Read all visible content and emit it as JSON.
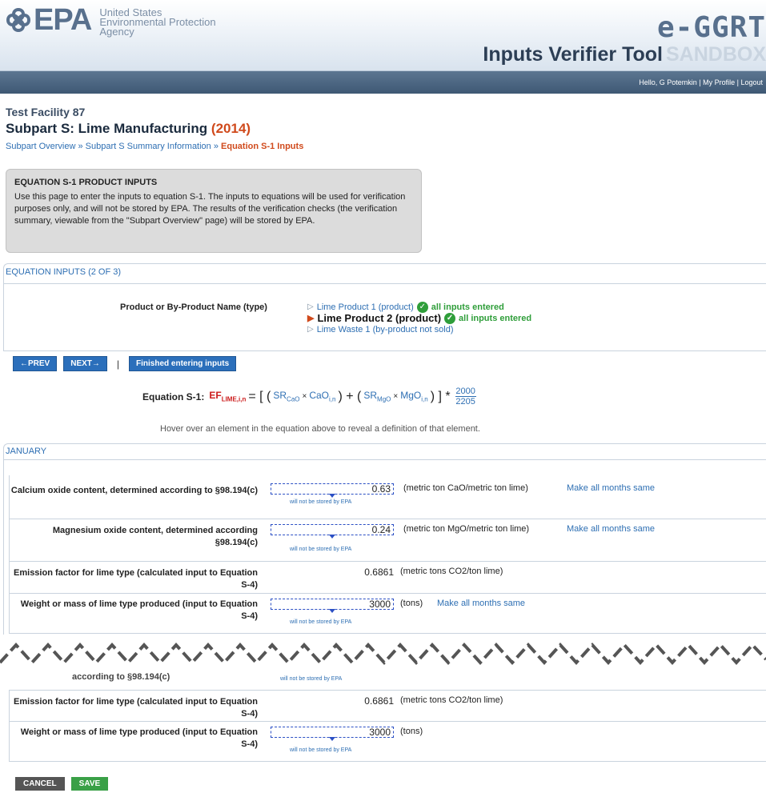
{
  "header": {
    "logo_text": "EPA",
    "agency_line1": "United States",
    "agency_line2": "Environmental Protection",
    "agency_line3": "Agency",
    "product": "e-GGRT",
    "tool": "Inputs Verifier Tool",
    "env": "SANDBOX",
    "user_greeting": "Hello, G Potemkin",
    "my_profile": "My Profile",
    "logout": "Logout"
  },
  "page": {
    "facility": "Test Facility 87",
    "subpart": "Subpart S: Lime Manufacturing",
    "year": "(2014)",
    "breadcrumb": [
      "Subpart Overview",
      "Subpart S Summary Information",
      "Equation S-1 Inputs"
    ]
  },
  "infobox": {
    "heading": "EQUATION S-1 PRODUCT INPUTS",
    "text": "Use this page to enter the inputs to equation S-1. The inputs to equations will be used for verification purposes only, and will not be stored by EPA. The results of the verification checks (the verification summary, viewable from the \"Subpart Overview\" page) will be stored by EPA."
  },
  "equation_inputs": {
    "title": "EQUATION INPUTS (2 OF 3)",
    "product_label": "Product or By-Product Name (type)",
    "products": [
      {
        "name": "Lime Product 1 (product)",
        "status": "all inputs entered"
      },
      {
        "name": "Lime Product 2 (product)",
        "status": "all inputs entered"
      },
      {
        "name": "Lime Waste 1 (by-product not sold)",
        "status": ""
      }
    ]
  },
  "nav": {
    "prev": "←PREV",
    "next": "NEXT→",
    "sep": "|",
    "finished": "Finished entering inputs"
  },
  "equation": {
    "label": "Equation S-1:",
    "ef": "EF",
    "ef_sub": "LIME,i,n",
    "open": "= [ (",
    "sr_cao": "SR",
    "sr_cao_sub": "CaO",
    "times1": "×",
    "cao": "CaO",
    "cao_sub": "i,n",
    "mid": ") + (",
    "sr_mgo": "SR",
    "sr_mgo_sub": "MgO",
    "times2": "×",
    "mgo": "MgO",
    "mgo_sub": "i,n",
    "close": ") ] *",
    "numerator": "2000",
    "denominator": "2205",
    "hover_note": "Hover over an element in the equation above to reveal a definition of that element."
  },
  "january": {
    "title": "JANUARY",
    "rows": [
      {
        "label": "Calcium oxide content, determined according to §98.194(c)",
        "value": "0.63",
        "unit": "(metric ton CaO/metric ton lime)",
        "link": "Make all months same"
      },
      {
        "label": "Magnesium oxide content, determined according §98.194(c)",
        "value": "0.24",
        "unit": "(metric ton MgO/metric ton lime)",
        "link": "Make all months same"
      },
      {
        "label": "Emission factor for lime type (calculated input to Equation S-4)",
        "value": "0.6861",
        "unit": "(metric tons CO2/ton lime)"
      },
      {
        "label": "Weight or mass of lime type produced (input to Equation S-4)",
        "value": "3000",
        "unit": "(tons)",
        "link": "Make all months same"
      }
    ],
    "nostore": "will not be stored by EPA"
  },
  "december": {
    "partial_label": "according to §98.194(c)",
    "rows": [
      {
        "label": "Emission factor for lime type (calculated input to Equation S-4)",
        "value": "0.6861",
        "unit": "(metric tons CO2/ton lime)"
      },
      {
        "label": "Weight or mass of lime type produced (input to Equation S-4)",
        "value": "3000",
        "unit": "(tons)"
      }
    ]
  },
  "actions": {
    "cancel": "CANCEL",
    "save": "SAVE"
  }
}
